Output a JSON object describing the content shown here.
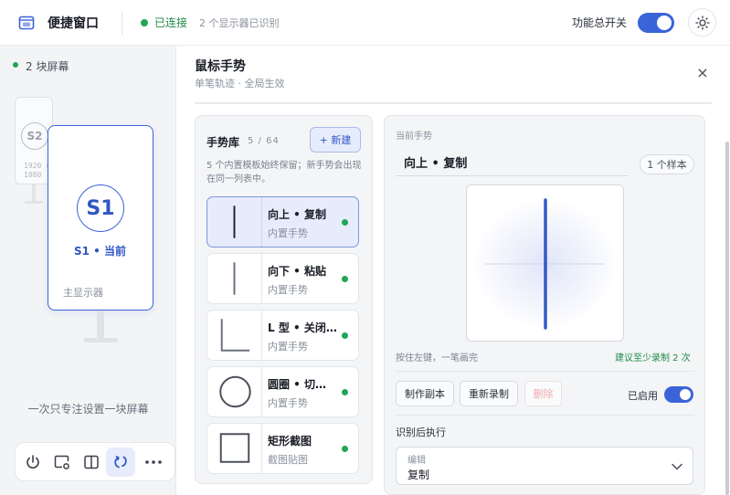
{
  "header": {
    "app_title": "便捷窗口",
    "connection_status": "已连接",
    "displays_detected": "2 个显示器已识别",
    "master_switch_label": "功能总开关",
    "master_switch_on": true
  },
  "left_panel": {
    "screens_count": "2 块屏幕",
    "secondary_screen": {
      "id": "S2",
      "resolution": "1920 ×\n1080"
    },
    "primary_screen": {
      "id": "S1",
      "name": "S1 • 当前",
      "role": "主显示器"
    },
    "focus_hint": "一次只专注设置一块屏幕",
    "dock": [
      {
        "icon": "power-icon"
      },
      {
        "icon": "window-settings-icon"
      },
      {
        "icon": "split-layout-icon"
      },
      {
        "icon": "gesture-icon",
        "active": true
      },
      {
        "icon": "more-icon"
      }
    ]
  },
  "panel": {
    "title": "鼠标手势",
    "subtitle": "单笔轨迹 · 全局生效",
    "close": "×"
  },
  "library": {
    "title": "手势库",
    "count": "5 / 64",
    "new_button": "+ 新建",
    "note": "5 个内置模板始终保留；新手势会出现在同一列表中。",
    "items": [
      {
        "name": "向上 • 复制",
        "type": "内置手势",
        "shape": "vertical-line",
        "selected": true,
        "status_color": "#22a454"
      },
      {
        "name": "向下 • 粘贴",
        "type": "内置手势",
        "shape": "vertical-line-short",
        "selected": false,
        "status_color": "#22a454"
      },
      {
        "name": "L 型 • 关闭...",
        "type": "内置手势",
        "shape": "l-shape",
        "selected": false,
        "status_color": "#22a454"
      },
      {
        "name": "圆圈 • 切换...",
        "type": "内置手势",
        "shape": "circle",
        "selected": false,
        "status_color": "#22a454"
      },
      {
        "name": "矩形截图",
        "type": "截图贴图",
        "shape": "square",
        "selected": false,
        "status_color": "#22a454"
      }
    ]
  },
  "current": {
    "label": "当前手势",
    "name": "向上 • 复制",
    "samples": "1 个样本",
    "draw_hint": "按住左键，一笔画完",
    "record_hint": "建议至少录制 2 次",
    "buttons": {
      "duplicate": "制作副本",
      "rerecord": "重新录制",
      "delete": "删除"
    },
    "enabled_label": "已启用",
    "enabled_on": true,
    "after_label": "识别后执行",
    "action_category": "编辑",
    "action_value": "复制"
  },
  "colors": {
    "accent": "#3b64d8",
    "success": "#22a454",
    "danger_disabled": "#f2a9ae"
  }
}
